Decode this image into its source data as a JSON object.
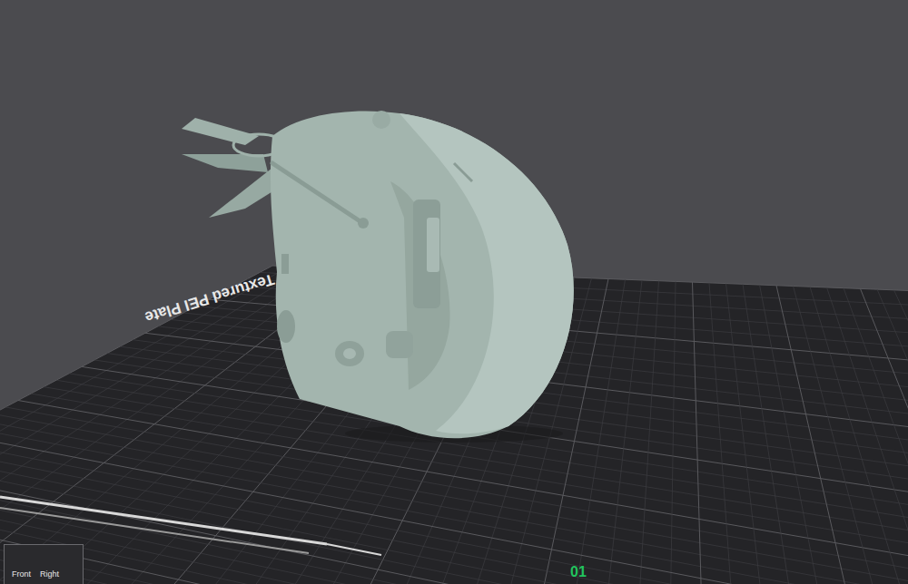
{
  "viewport": {
    "plate": {
      "label": "Textured PEI Plate",
      "number": "01"
    }
  },
  "nav_cube": {
    "faces": [
      "Front",
      "Right"
    ]
  }
}
